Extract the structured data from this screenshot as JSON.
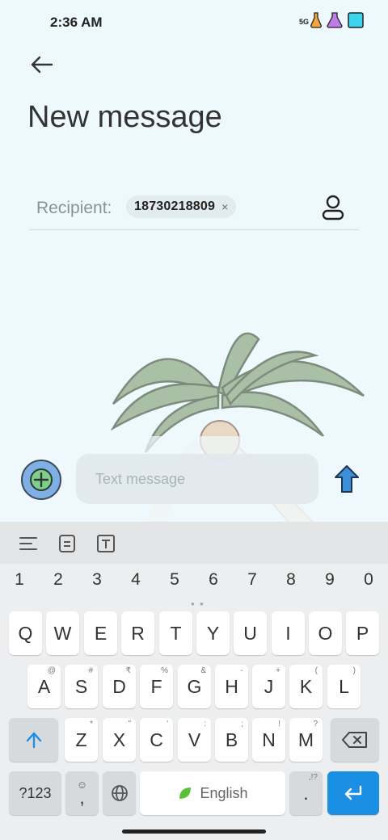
{
  "status": {
    "time": "2:36 AM",
    "network_label": "5G"
  },
  "header": {
    "title": "New message"
  },
  "recipient": {
    "label": "Recipient:",
    "chip": "18730218809",
    "chip_remove": "×"
  },
  "compose": {
    "placeholder": "Text message"
  },
  "keyboard": {
    "numbers": [
      "1",
      "2",
      "3",
      "4",
      "5",
      "6",
      "7",
      "8",
      "9",
      "0"
    ],
    "row1": [
      "Q",
      "W",
      "E",
      "R",
      "T",
      "Y",
      "U",
      "I",
      "O",
      "P"
    ],
    "row2": [
      "A",
      "S",
      "D",
      "F",
      "G",
      "H",
      "J",
      "K",
      "L"
    ],
    "row2_hints": [
      "@",
      "#",
      "₹",
      "%",
      "&",
      "-",
      "+",
      "(",
      ")"
    ],
    "row3": [
      "Z",
      "X",
      "C",
      "V",
      "B",
      "N",
      "M"
    ],
    "row3_hints": [
      "*",
      "\"",
      "'",
      ":",
      ";",
      "!",
      "?"
    ],
    "symbols_key": "?123",
    "comma_key": ",",
    "space_label": "English",
    "period_key": ".",
    "period_hint": ",!?"
  },
  "colors": {
    "accent": "#1a8fe3",
    "background": "#eef9fd",
    "plus_button": "#7fb0e5"
  }
}
